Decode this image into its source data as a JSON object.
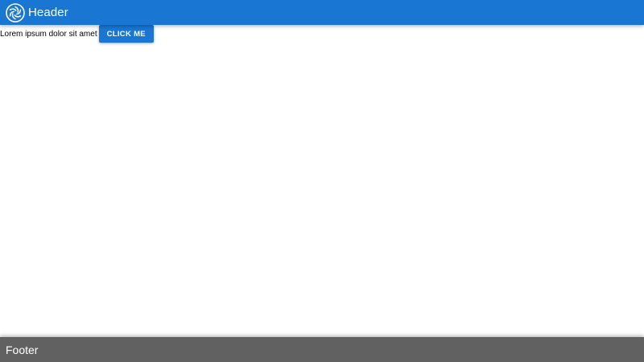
{
  "header": {
    "title": "Header",
    "logo_icon": "aperture-logo-icon",
    "background": "#1976d2"
  },
  "main": {
    "text": "Lorem ipsum dolor sit amet",
    "button_label": "CLICK ME",
    "button_color": "#1976d2"
  },
  "footer": {
    "title": "Footer",
    "background": "#616161"
  }
}
